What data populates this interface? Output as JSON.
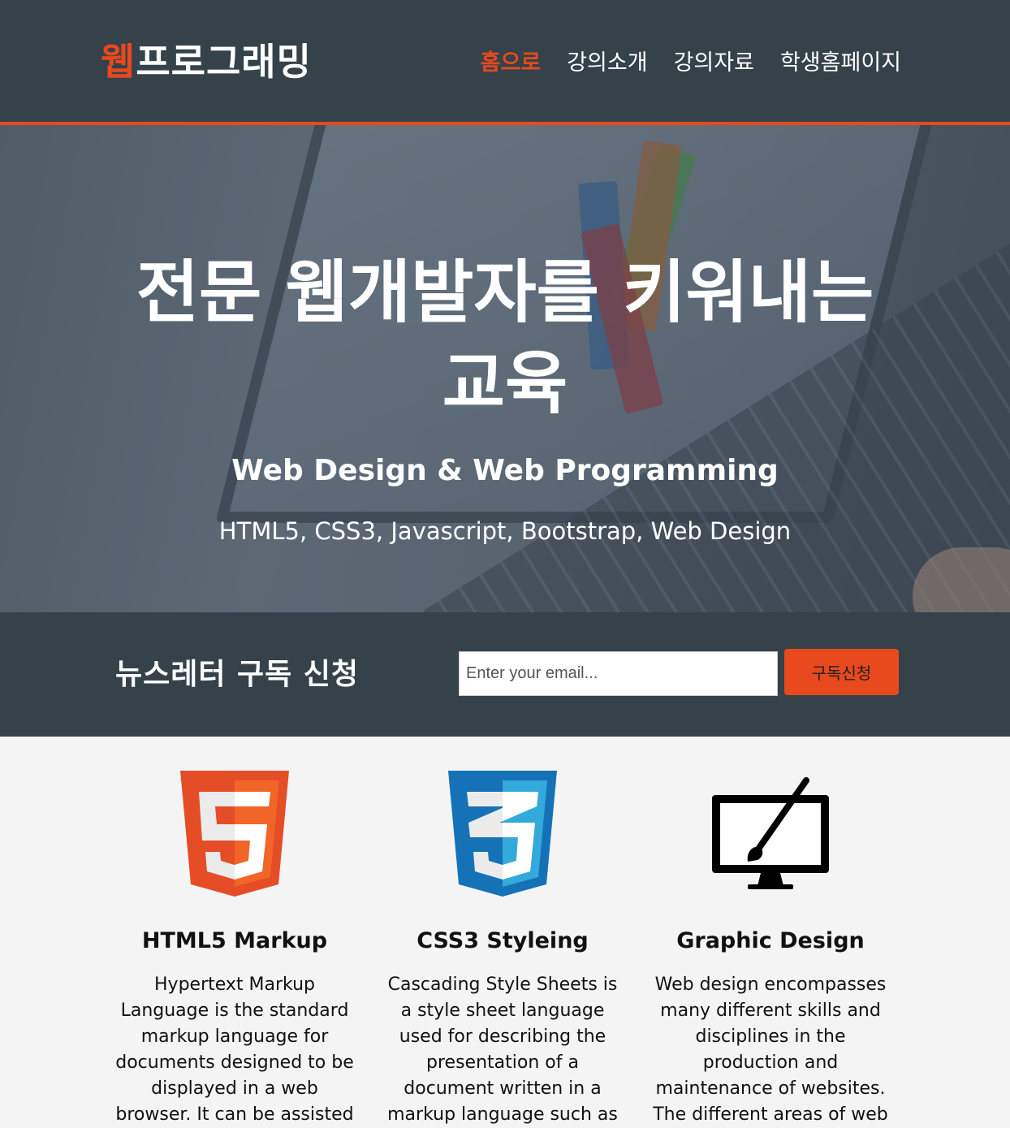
{
  "header": {
    "logo_highlight": "웹",
    "logo_rest": "프로그래밍",
    "nav": [
      {
        "label": "홈으로",
        "active": true
      },
      {
        "label": "강의소개",
        "active": false
      },
      {
        "label": "강의자료",
        "active": false
      },
      {
        "label": "학생홈페이지",
        "active": false
      }
    ]
  },
  "showcase": {
    "title": "전문 웹개발자를 키워내는 교육",
    "subtitle": "Web Design & Web Programming",
    "tagline": "HTML5, CSS3, Javascript, Bootstrap, Web Design"
  },
  "newsletter": {
    "heading": "뉴스레터 구독 신청",
    "email_placeholder": "Enter your email...",
    "email_value": "",
    "button_label": "구독신청"
  },
  "boxes": [
    {
      "icon": "html5-logo-icon",
      "title": "HTML5 Markup",
      "text": "Hypertext Markup Language is the standard markup language for documents designed to be displayed in a web browser. It can be assisted"
    },
    {
      "icon": "css3-logo-icon",
      "title": "CSS3 Styleing",
      "text": "Cascading Style Sheets is a style sheet language used for describing the presentation of a document written in a markup language such as"
    },
    {
      "icon": "graphic-design-monitor-icon",
      "title": "Graphic Design",
      "text": "Web design encompasses many different skills and disciplines in the production and maintenance of websites. The different areas of web"
    }
  ],
  "colors": {
    "dark": "#35424a",
    "accent": "#e8491d",
    "html5_orange": "#e44d26",
    "css3_blue": "#1572b6"
  }
}
